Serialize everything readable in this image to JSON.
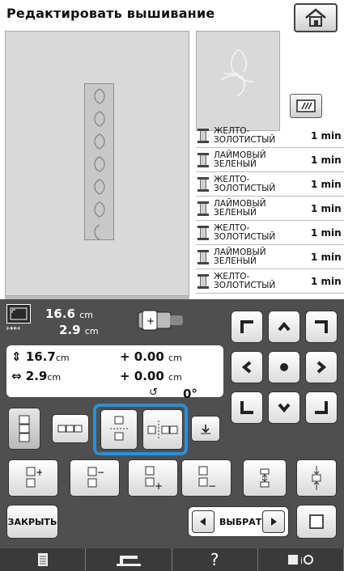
{
  "header": {
    "title": "Редактировать вышивание"
  },
  "colors": {
    "panel": "#4f4f4f",
    "highlight": "#2a8fd6"
  },
  "thread_list": [
    {
      "name": "ЖЕЛТО-ЗОЛОТИСТЫЙ",
      "time": "1 min"
    },
    {
      "name": "ЛАЙМОВЫЙ ЗЕЛЕНЫЙ",
      "time": "1 min"
    },
    {
      "name": "ЖЕЛТО-ЗОЛОТИСТЫЙ",
      "time": "1 min"
    },
    {
      "name": "ЛАЙМОВЫЙ ЗЕЛЕНЫЙ",
      "time": "1 min"
    },
    {
      "name": "ЖЕЛТО-ЗОЛОТИСТЫЙ",
      "time": "1 min"
    },
    {
      "name": "ЛАЙМОВЫЙ ЗЕЛЕНЫЙ",
      "time": "1 min"
    },
    {
      "name": "ЖЕЛТО-ЗОЛОТИСТЫЙ",
      "time": "1 min"
    }
  ],
  "size": {
    "width": "16.6",
    "height": "2.9",
    "unit": "cm"
  },
  "info": {
    "height": "16.7",
    "width": "2.9",
    "unit": "cm",
    "offset_x": "+ 0.00",
    "offset_y": "+ 0.00",
    "rotation": "0°"
  },
  "buttons": {
    "close": "ЗАКРЫТЬ",
    "select": "ВЫБРАТЬ"
  },
  "icons": [
    "home-icon",
    "display-icon",
    "arrow-up-icon",
    "arrow-down-icon",
    "arrow-left-icon",
    "arrow-right-icon",
    "center-icon",
    "corner-icon",
    "spool-icon",
    "rotate-icon",
    "sheet-icon",
    "machine-icon",
    "help-icon"
  ]
}
